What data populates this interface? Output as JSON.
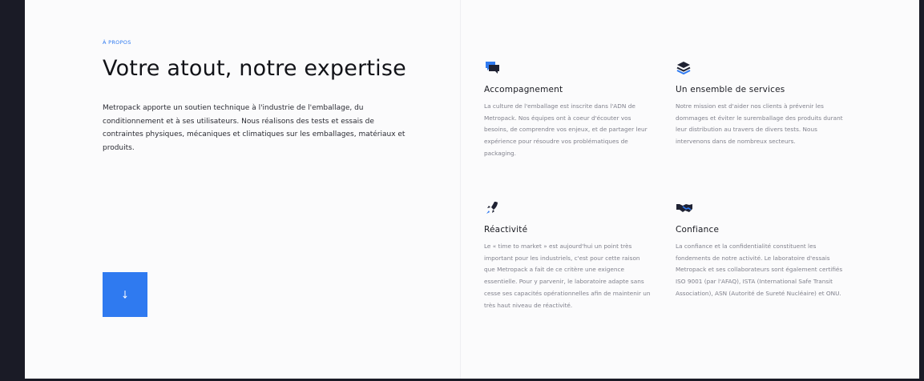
{
  "about": {
    "eyebrow": "À PROPOS",
    "title": "Votre atout, notre expertise",
    "intro": "Metropack apporte un soutien technique à l'industrie de l'emballage, du conditionnement et à ses utilisateurs. Nous réalisons des tests et essais de contraintes physiques, mécaniques et climatiques sur les emballages, matériaux et produits.",
    "scroll_button_icon": "arrow-down-icon"
  },
  "features": [
    {
      "icon": "chat-bubbles-icon",
      "title": "Accompagnement",
      "text": "La culture de l'emballage est inscrite dans l'ADN de Metropack. Nos équipes ont à coeur d'écouter vos besoins, de comprendre vos enjeux, et de partager leur expérience pour résoudre vos problématiques de packaging."
    },
    {
      "icon": "layers-icon",
      "title": "Un ensemble de services",
      "text": "Notre mission est d'aider nos clients à prévenir les dommages et éviter le suremballage des produits durant leur distribution au travers de divers tests. Nous intervenons dans de nombreux secteurs."
    },
    {
      "icon": "rocket-icon",
      "title": "Réactivité",
      "text": "Le « time to market » est aujourd'hui un point très important pour les industriels, c'est pour cette raison que Metropack a fait de ce critère une exigence essentielle. Pour y parvenir, le laboratoire adapte sans cesse ses capacités opérationnelles afin de maintenir un très haut niveau de réactivité."
    },
    {
      "icon": "handshake-icon",
      "title": "Confiance",
      "text": "La confiance et la confidentialité constituent les fondements de notre activité. Le laboratoire d'essais Metropack et ses collaborateurs sont également certifiés ISO 9001 (par l'AFAQ), ISTA (International Safe Transit Association), ASN (Autorité de Sureté Nucléaire) et ONU."
    }
  ],
  "colors": {
    "accent": "#2f7af0",
    "icon": "#1f2233",
    "background": "#fbfbfc",
    "outer": "#1a1b26"
  }
}
